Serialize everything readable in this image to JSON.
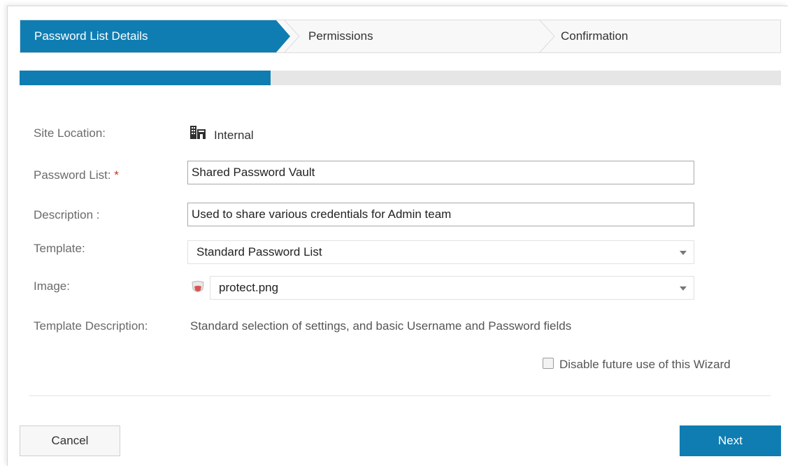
{
  "wizard": {
    "steps": [
      {
        "label": "Password List Details",
        "active": true
      },
      {
        "label": "Permissions",
        "active": false
      },
      {
        "label": "Confirmation",
        "active": false
      }
    ],
    "progress_fraction": 0.33,
    "accent_color": "#0f7db2"
  },
  "form": {
    "site_location": {
      "label": "Site Location:",
      "value": "Internal",
      "icon": "building-icon"
    },
    "password_list": {
      "label": "Password List:",
      "required_mark": "*",
      "value": "Shared Password Vault"
    },
    "description": {
      "label": "Description :",
      "value": "Used to share various credentials for Admin team"
    },
    "template": {
      "label": "Template:",
      "selected": "Standard Password List"
    },
    "image": {
      "label": "Image:",
      "selected": "protect.png",
      "icon": "shield-image-icon"
    },
    "template_description": {
      "label": "Template Description:",
      "value": "Standard selection of settings, and basic Username and Password fields"
    },
    "disable_wizard": {
      "label": "Disable future use of this Wizard",
      "checked": false
    }
  },
  "actions": {
    "cancel_label": "Cancel",
    "next_label": "Next"
  }
}
